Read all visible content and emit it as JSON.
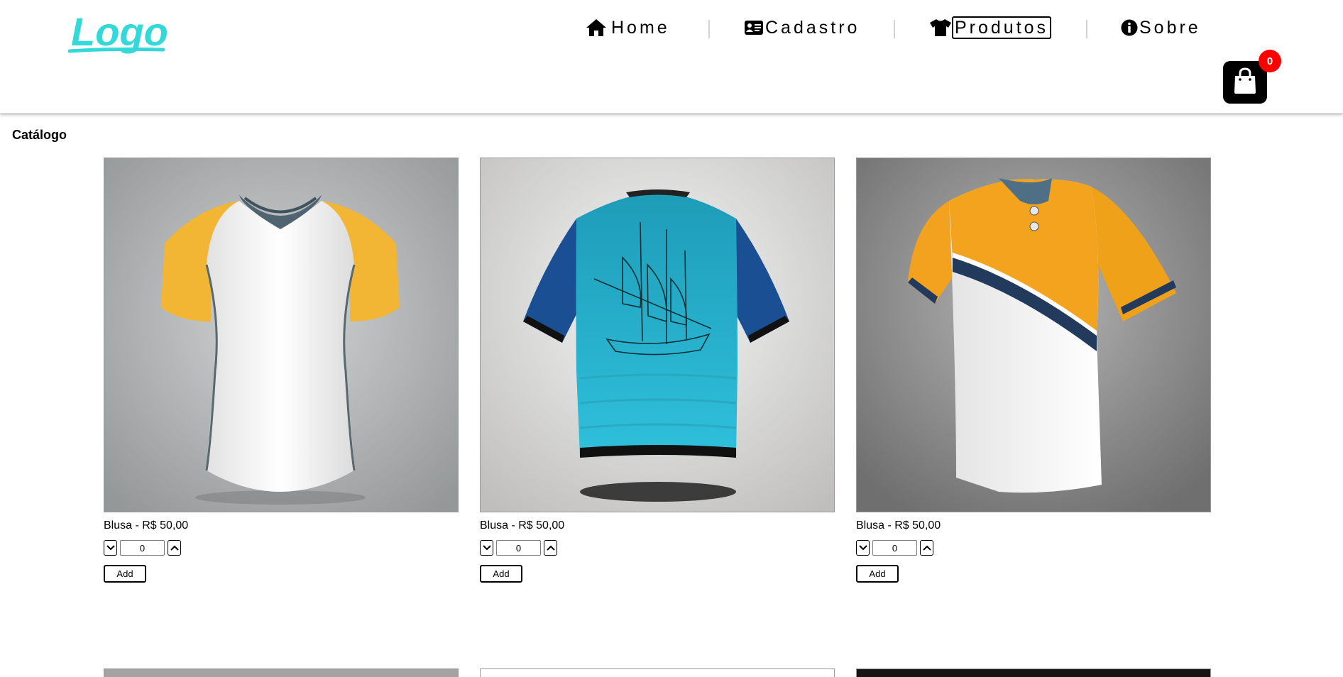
{
  "header": {
    "logo_text": "Logo",
    "logo_color": "#33d9d9",
    "nav": [
      {
        "label": "Home",
        "icon": "home-icon"
      },
      {
        "label": "Cadastro",
        "icon": "id-card-icon"
      },
      {
        "label": "Produtos",
        "icon": "tshirt-icon",
        "active": true
      },
      {
        "label": "Sobre",
        "icon": "info-icon"
      }
    ],
    "cart": {
      "count": "0",
      "icon": "shopping-bag-icon",
      "badge_color": "#ff0000"
    }
  },
  "catalog": {
    "title": "Catálogo",
    "products": [
      {
        "caption": "Blusa - R$ 50,00",
        "quantity": "0",
        "add_label": "Add",
        "image": "tshirt-white-yellow"
      },
      {
        "caption": "Blusa - R$ 50,00",
        "quantity": "0",
        "add_label": "Add",
        "image": "tshirt-teal-ship"
      },
      {
        "caption": "Blusa - R$ 50,00",
        "quantity": "0",
        "add_label": "Add",
        "image": "tshirt-orange-stripe"
      }
    ]
  }
}
